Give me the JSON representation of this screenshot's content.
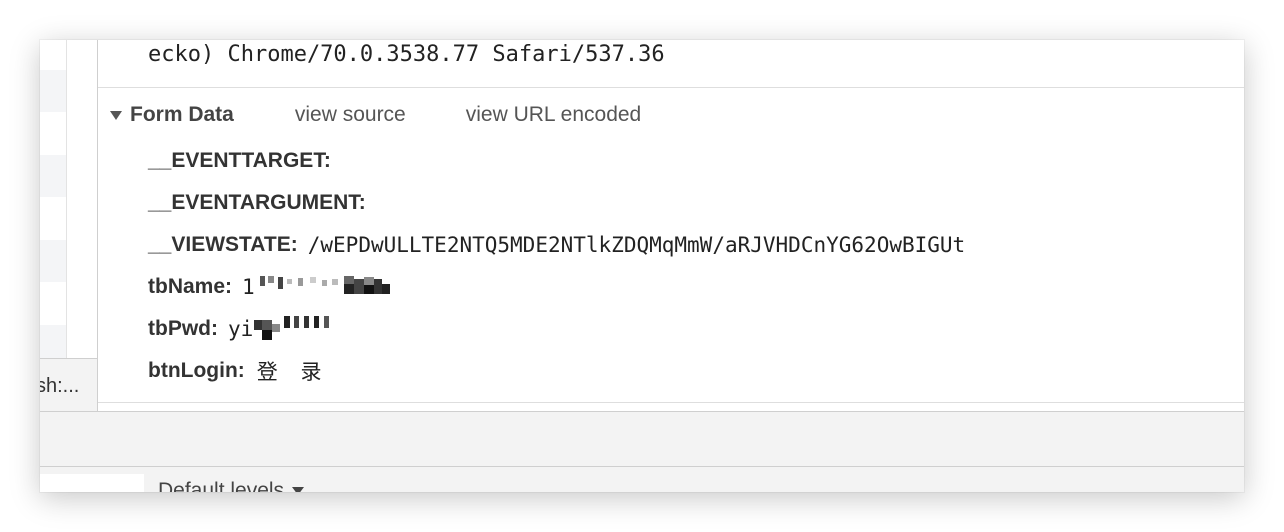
{
  "request_headers": {
    "user_agent_tail": "ecko) Chrome/70.0.3538.77 Safari/537.36"
  },
  "form_data": {
    "title": "Form Data",
    "view_source_label": "view source",
    "view_url_encoded_label": "view URL encoded",
    "fields": [
      {
        "key": "__EVENTTARGET:",
        "value": ""
      },
      {
        "key": "__EVENTARGUMENT:",
        "value": ""
      },
      {
        "key": "__VIEWSTATE:",
        "value": "/wEPDwULLTE2NTQ5MDE2NTlkZDQMqMmW/aRJVHDCnYG62OwBIGUt"
      },
      {
        "key": "tbName:",
        "value": "1"
      },
      {
        "key": "tbPwd:",
        "value": "yi"
      },
      {
        "key": "btnLogin:",
        "value": "登 录"
      }
    ]
  },
  "left_panel": {
    "truncated_label": "sh:..."
  },
  "console": {
    "levels_label": "Default levels"
  },
  "colors": {
    "border": "#cfcfcf",
    "toolbar_bg": "#f3f3f3",
    "row_alt": "#f4f5f7"
  }
}
